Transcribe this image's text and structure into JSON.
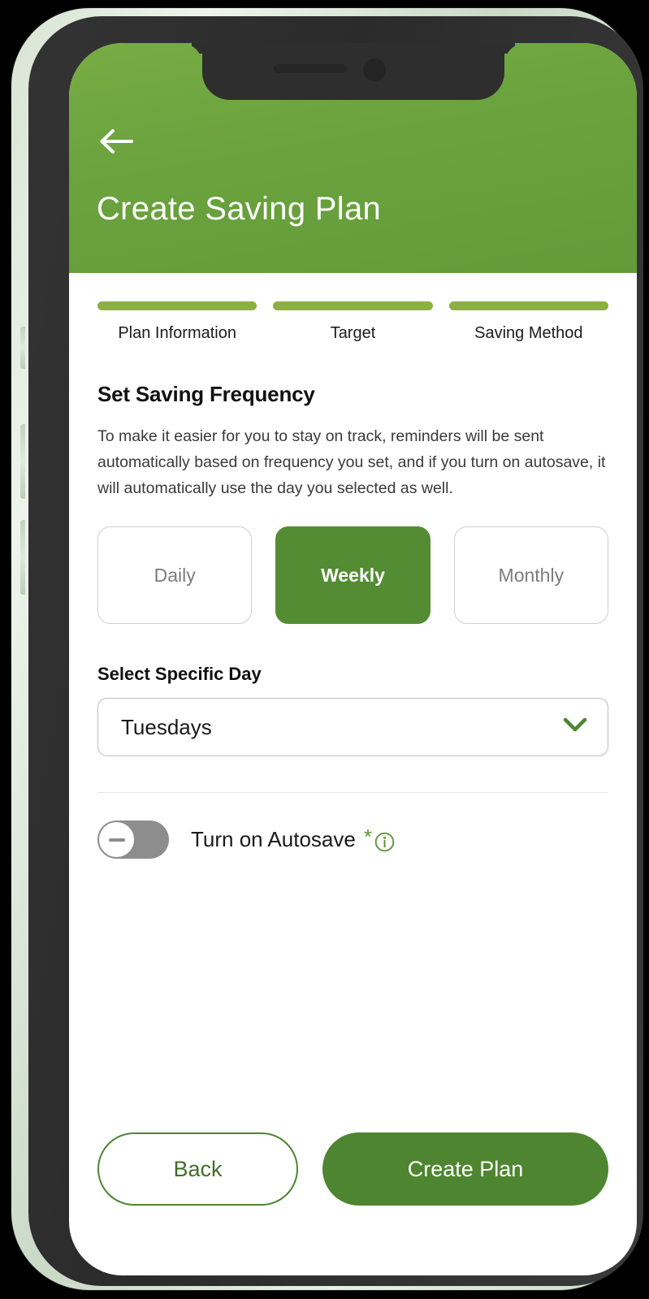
{
  "header": {
    "title": "Create Saving Plan",
    "back_icon": "arrow-left-icon"
  },
  "progress": {
    "steps": [
      {
        "label": "Plan Information",
        "state": "complete"
      },
      {
        "label": "Target",
        "state": "complete"
      },
      {
        "label": "Saving Method",
        "state": "complete"
      }
    ]
  },
  "section": {
    "title": "Set Saving Frequency",
    "description": "To make it easier for you to stay on track, reminders will be sent automatically based on frequency you set, and if you turn on autosave, it will automatically use the day you selected as well."
  },
  "frequency": {
    "options": [
      {
        "label": "Daily",
        "selected": false
      },
      {
        "label": "Weekly",
        "selected": true
      },
      {
        "label": "Monthly",
        "selected": false
      }
    ]
  },
  "specific_day": {
    "label": "Select Specific Day",
    "value": "Tuesdays",
    "chevron_icon": "chevron-down-icon"
  },
  "autosave": {
    "label": "Turn on Autosave",
    "required_marker": "*",
    "info_icon": "info-circle-icon",
    "enabled": false
  },
  "footer": {
    "back_label": "Back",
    "create_label": "Create Plan"
  },
  "colors": {
    "header_green": "#6ba33e",
    "accent_green": "#548c33",
    "step_green": "#8cb045",
    "button_green": "#4e8530",
    "toggle_off_gray": "#8d8d8d"
  }
}
